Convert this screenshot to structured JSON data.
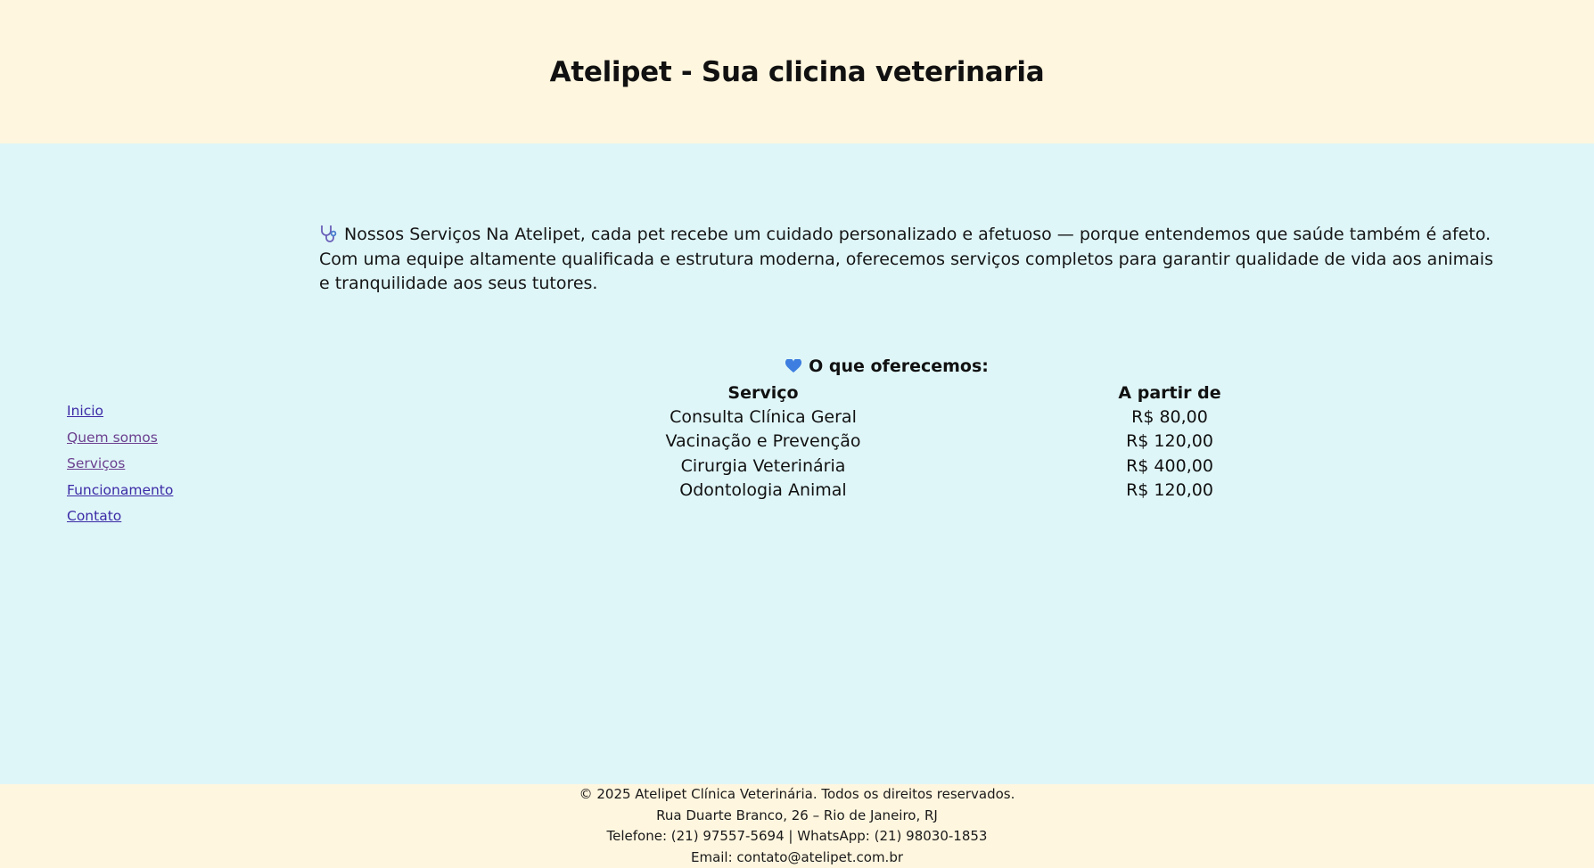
{
  "header": {
    "title": "Atelipet - Sua clicina veterinaria"
  },
  "nav": {
    "items": [
      {
        "label": "Inicio"
      },
      {
        "label": "Quem somos"
      },
      {
        "label": "Serviços"
      },
      {
        "label": "Funcionamento"
      },
      {
        "label": "Contato"
      }
    ]
  },
  "intro": {
    "icon": "stethoscope-icon",
    "text": "Nossos Serviços Na Atelipet, cada pet recebe um cuidado personalizado e afetuoso — porque entendemos que saúde também é afeto. Com uma equipe altamente qualificada e estrutura moderna, oferecemos serviços completos para garantir qualidade de vida aos animais e tranquilidade aos seus tutores."
  },
  "offer": {
    "icon": "blue-heart-icon",
    "title": "O que oferecemos:",
    "columns": [
      "Serviço",
      "A partir de"
    ],
    "rows": [
      [
        "Consulta Clínica Geral",
        "R$ 80,00"
      ],
      [
        "Vacinação e Prevenção",
        "R$ 120,00"
      ],
      [
        "Cirurgia Veterinária",
        "R$ 400,00"
      ],
      [
        "Odontologia Animal",
        "R$ 120,00"
      ]
    ]
  },
  "footer": {
    "copyright": "© 2025 Atelipet Clínica Veterinária. Todos os direitos reservados.",
    "address": "Rua Duarte Branco, 26 – Rio de Janeiro, RJ",
    "phones": "Telefone: (21) 97557-5694 | WhatsApp: (21) 98030-1853",
    "email": "Email: contato@atelipet.com.br"
  },
  "colors": {
    "header_bg": "#fff6df",
    "main_bg": "#dff6f8",
    "link": "#3b2aa6",
    "visited_link": "#6b3f8f",
    "heart": "#3d7ee0"
  }
}
